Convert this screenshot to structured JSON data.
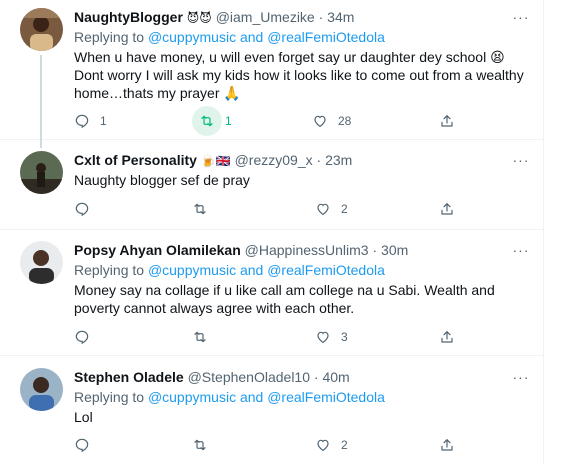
{
  "tweets": [
    {
      "name": "NaughtyBlogger",
      "name_emoji": "😈😈",
      "handle": "@iam_Umezike",
      "sep": "·",
      "time": "34m",
      "more": "···",
      "replying_prefix": "Replying to",
      "mentions": "@cuppymusic and @realFemiOtedola",
      "text": "When u have money, u will even forget say ur daughter dey school 😫 Dont worry I will ask my kids how it looks like to come out from a wealthy home…thats my prayer 🙏",
      "reply_count": "1",
      "retweet_count": "1",
      "like_count": "28",
      "retweeted": true
    },
    {
      "name": "Cxlt of Personality",
      "name_emoji": "🍺🇬🇧",
      "handle": "@rezzy09_x",
      "sep": "·",
      "time": "23m",
      "more": "···",
      "text": "Naughty blogger sef de pray",
      "reply_count": "",
      "retweet_count": "",
      "like_count": "2"
    },
    {
      "name": "Popsy Ahyan Olamilekan",
      "handle": "@HappinessUnlim3",
      "sep": "·",
      "time": "30m",
      "more": "···",
      "replying_prefix": "Replying to",
      "mentions": "@cuppymusic and @realFemiOtedola",
      "text": "Money say na collage if u like call am college na u Sabi. Wealth and poverty cannot always agree with each other.",
      "reply_count": "",
      "retweet_count": "",
      "like_count": "3"
    },
    {
      "name": "Stephen Oladele",
      "handle": "@StephenOladel10",
      "sep": "·",
      "time": "40m",
      "more": "···",
      "replying_prefix": "Replying to",
      "mentions": "@cuppymusic and @realFemiOtedola",
      "text": "Lol",
      "reply_count": "",
      "retweet_count": "",
      "like_count": "2"
    }
  ],
  "icons": {
    "reply": "reply-icon",
    "retweet": "retweet-icon",
    "like": "heart-icon",
    "share": "share-icon"
  },
  "colors": {
    "accent": "#1d9bf0",
    "retweet_active": "#00ba7c",
    "muted": "#536471"
  }
}
